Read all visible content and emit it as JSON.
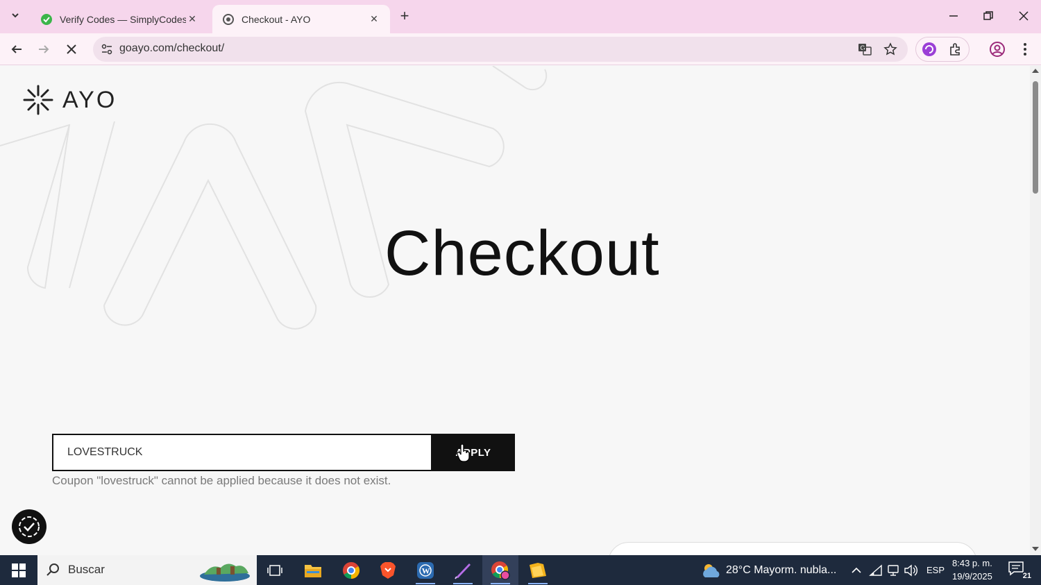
{
  "browser": {
    "tabs": [
      {
        "title": "Verify Codes — SimplyCodes",
        "active": false
      },
      {
        "title": "Checkout - AYO",
        "active": true
      }
    ],
    "url": "goayo.com/checkout/"
  },
  "page": {
    "logo_text": "AYO",
    "heading": "Checkout",
    "coupon": {
      "value": "LOVESTRUCK",
      "apply_label": "APPLY",
      "error": "Coupon \"lovestruck\" cannot be applied because it does not exist."
    }
  },
  "taskbar": {
    "search_placeholder": "Buscar",
    "weather": "28°C  Mayorm. nubla...",
    "language": "ESP",
    "time": "8:43 p. m.",
    "date": "19/9/2025",
    "notifications": "21"
  },
  "colors": {
    "tab_strip": "#f6d6ec",
    "toolbar": "#fdf2f8",
    "button": "#111111",
    "taskbar": "#1e2a3d"
  }
}
